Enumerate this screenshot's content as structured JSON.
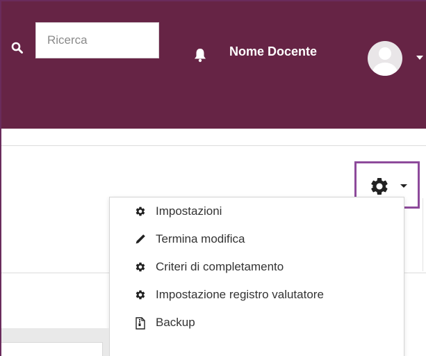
{
  "navbar": {
    "search": {
      "placeholder": "Ricerca",
      "icon": "search-icon"
    },
    "notifications": {
      "icon": "bell-icon"
    },
    "user": {
      "name": "Nome Docente",
      "avatar_icon": "avatar-icon",
      "caret_icon": "caret-down-icon"
    },
    "colors": {
      "background": "#662445",
      "text": "#ffffff"
    }
  },
  "page_header": {
    "actions_button": {
      "icon": "gear-icon",
      "caret_icon": "caret-down-icon",
      "highlight_color": "#8d4a9b"
    }
  },
  "actions_menu": {
    "items": [
      {
        "label": "Impostazioni",
        "icon": "gear-icon"
      },
      {
        "label": "Termina modifica",
        "icon": "pencil-icon"
      },
      {
        "label": "Criteri di completamento",
        "icon": "gear-icon"
      },
      {
        "label": "Impostazione registro valutatore",
        "icon": "gear-icon"
      },
      {
        "label": "Backup",
        "icon": "file-archive-icon"
      }
    ]
  }
}
